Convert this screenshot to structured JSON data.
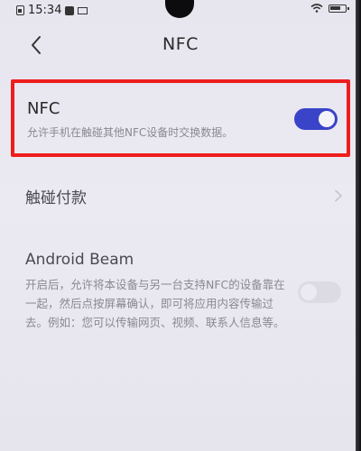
{
  "status_bar": {
    "time": "15:34"
  },
  "header": {
    "title": "NFC",
    "back_icon": "chevron-left-icon"
  },
  "nfc": {
    "title": "NFC",
    "description": "允许手机在触碰其他NFC设备时交换数据。",
    "enabled": true
  },
  "payment": {
    "label": "触碰付款",
    "chevron_icon": "chevron-right-icon"
  },
  "android_beam": {
    "title": "Android Beam",
    "description": "开启后，允许将本设备与另一台支持NFC的设备靠在一起，然后点按屏幕确认，即可将应用内容传输过去。例如：您可以传输网页、视频、联系人信息等。",
    "enabled": false
  },
  "colors": {
    "highlight": "#ee1d1d",
    "toggle_on": "#3a44c8",
    "background": "#e9e7f0"
  }
}
